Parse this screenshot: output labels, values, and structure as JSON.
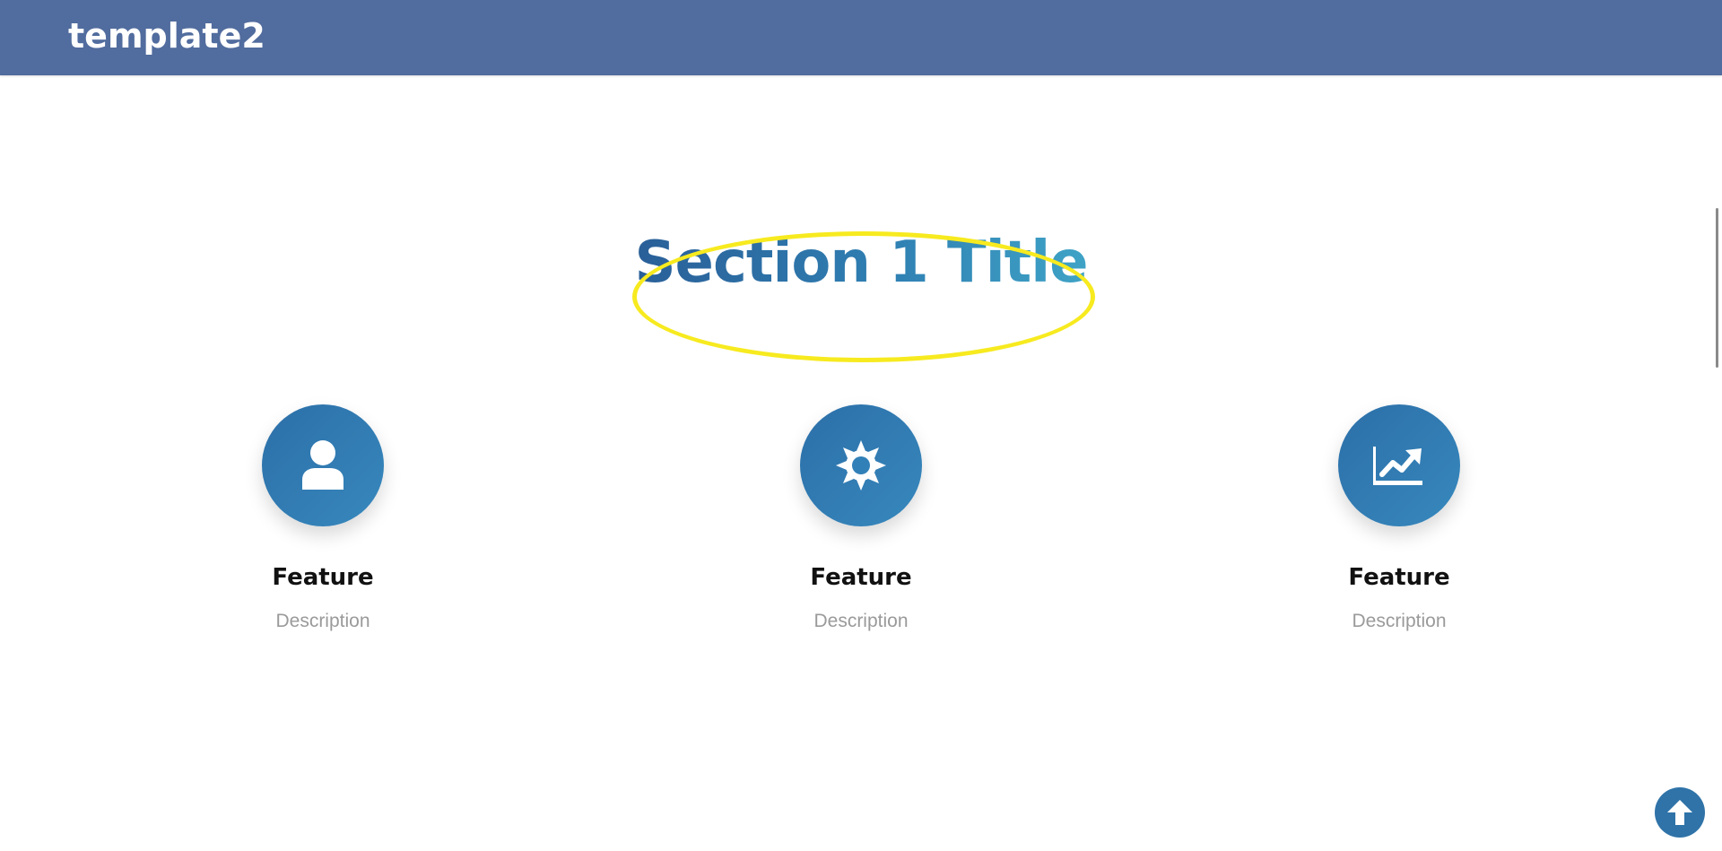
{
  "header": {
    "brand": "template2"
  },
  "section": {
    "title": "Section 1 Title"
  },
  "features": [
    {
      "icon": "user-icon",
      "title": "Feature",
      "description": "Description"
    },
    {
      "icon": "sun-gear-icon",
      "title": "Feature",
      "description": "Description"
    },
    {
      "icon": "chart-line-icon",
      "title": "Feature",
      "description": "Description"
    }
  ],
  "colors": {
    "navbar": "#516c9e",
    "accent": "#2f73a8",
    "title_gradient_start": "#2a5f98",
    "title_gradient_end": "#3fa3c6",
    "highlight": "#f7ea1f"
  },
  "back_to_top": {
    "icon": "arrow-up-circle-icon"
  }
}
